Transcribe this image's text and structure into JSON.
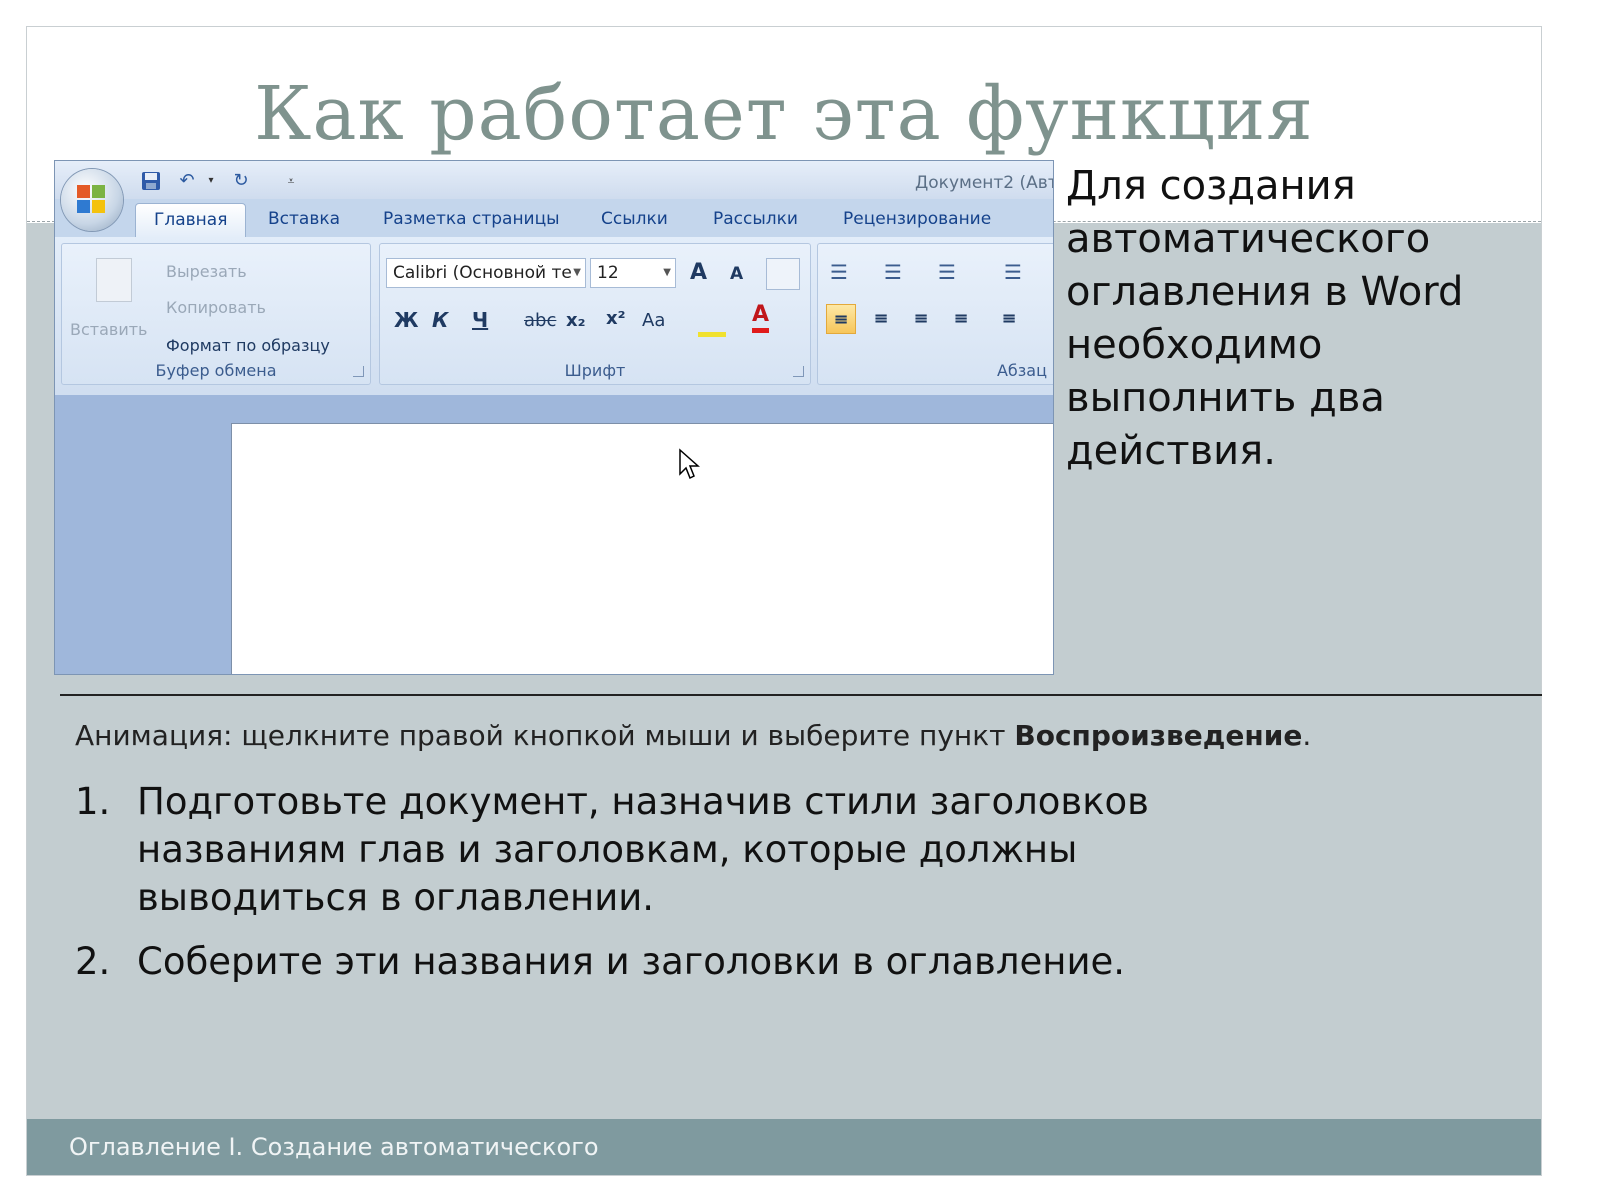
{
  "slide": {
    "title": "Как работает эта функция",
    "side_text": "Для создания автоматического оглавления в Word необходимо выполнить два действия.",
    "animation_prefix": "Анимация: щелкните правой кнопкой мыши и выберите пункт ",
    "animation_bold": "Воспроизведение",
    "animation_suffix": ".",
    "steps": [
      {
        "num": "1.",
        "text": "Подготовьте документ, назначив стили заголовков названиям глав и заголовкам, которые должны выводиться в оглавлении."
      },
      {
        "num": "2.",
        "text": "Соберите эти названия и заголовки в оглавление."
      }
    ],
    "footer": "Оглавление I. Создание автоматического"
  },
  "word": {
    "doc_title": "Документ2 (Авт",
    "tabs": [
      "Главная",
      "Вставка",
      "Разметка страницы",
      "Ссылки",
      "Рассылки",
      "Рецензирование"
    ],
    "clipboard": {
      "paste": "Вставить",
      "cut": "Вырезать",
      "copy": "Копировать",
      "format_painter": "Формат по образцу",
      "group_label": "Буфер обмена"
    },
    "font": {
      "font_name": "Calibri (Основной те",
      "font_size": "12",
      "group_label": "Шрифт",
      "buttons": [
        "Ж",
        "К",
        "Ч",
        "abc",
        "x₂",
        "x²",
        "Aa"
      ]
    },
    "paragraph": {
      "group_label": "Абзац"
    }
  },
  "colors": {
    "slide_bg": "#c3cdd0",
    "title": "#7f938e",
    "footer_bg": "#7f9a9f",
    "ribbon_text": "#15428b"
  }
}
